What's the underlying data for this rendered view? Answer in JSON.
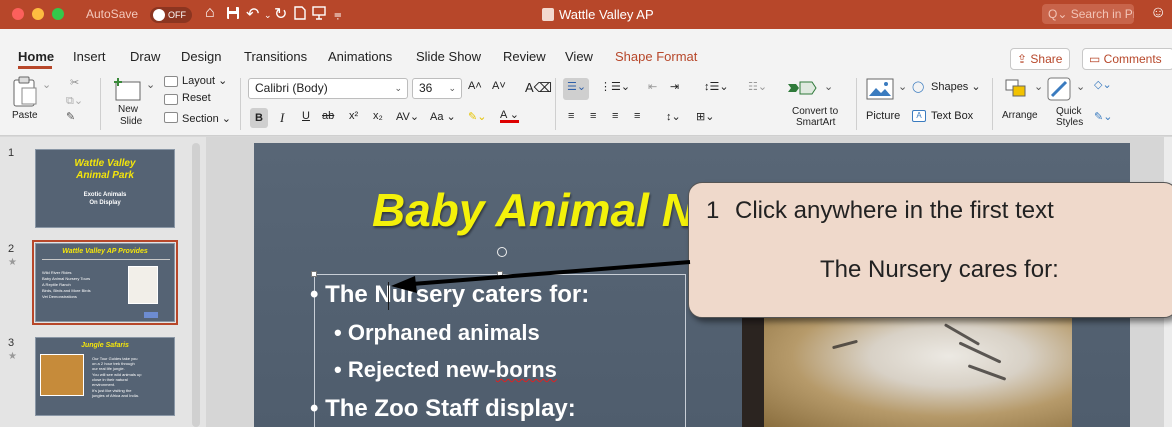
{
  "window": {
    "autosave_label": "AutoSave",
    "autosave_state": "OFF",
    "title": "Wattle Valley AP",
    "search_placeholder": "Search in Presentation"
  },
  "tabs": [
    {
      "label": "Home"
    },
    {
      "label": "Insert"
    },
    {
      "label": "Draw"
    },
    {
      "label": "Design"
    },
    {
      "label": "Transitions"
    },
    {
      "label": "Animations"
    },
    {
      "label": "Slide Show"
    },
    {
      "label": "Review"
    },
    {
      "label": "View"
    },
    {
      "label": "Shape Format"
    }
  ],
  "actions": {
    "share": "Share",
    "comments": "Comments"
  },
  "ribbon": {
    "paste": "Paste",
    "new_slide": [
      "New",
      "Slide"
    ],
    "layout": "Layout",
    "reset": "Reset",
    "section": "Section",
    "font_name": "Calibri (Body)",
    "font_size": "36",
    "font_case": "Aa",
    "convert": [
      "Convert to",
      "SmartArt"
    ],
    "picture": "Picture",
    "text_box": "Text Box",
    "shapes": "Shapes",
    "arrange": "Arrange",
    "quick_styles": [
      "Quick",
      "Styles"
    ]
  },
  "thumbnails": [
    {
      "num": "1",
      "title": [
        "Wattle Valley",
        "Animal Park"
      ],
      "sub": [
        "Exotic Animals",
        "On Display"
      ]
    },
    {
      "num": "2",
      "title": [
        "Wattle Valley AP Provides"
      ],
      "lines": [
        "Wild River Rides",
        "Baby Animal Nursery Tours",
        "A Reptile Ranch",
        "Birds, Birds and More Birds",
        "Vet Demonstrations"
      ]
    },
    {
      "num": "3",
      "title": [
        "Jungle Safaris"
      ],
      "lines": [
        "Our Tour Guides take you",
        "on a 2 hour trek through",
        "our real life jungle.",
        "You will see wild animals up",
        "close in their natural",
        "environment.",
        "It's just like visiting the",
        "jungles of Africa and India."
      ]
    }
  ],
  "slide": {
    "title": "Baby Animal Nursery",
    "bullets": [
      {
        "level": 1,
        "text_before": "The ",
        "text_after": "Nursery caters for:"
      },
      {
        "level": 2,
        "text": "Orphaned animals"
      },
      {
        "level": 2,
        "text_before": "Rejected new-",
        "text_wavy": "borns"
      },
      {
        "level": 1,
        "text": "The Zoo Staff display:"
      }
    ]
  },
  "callout": {
    "step": "1",
    "instruction": "Click anywhere in the first text",
    "example": "The Nursery cares for:"
  },
  "colors": {
    "accent": "#b7472a",
    "slide_bg": "#556374",
    "title_yellow": "#f4f10a",
    "callout_bg": "#efd9cb"
  }
}
